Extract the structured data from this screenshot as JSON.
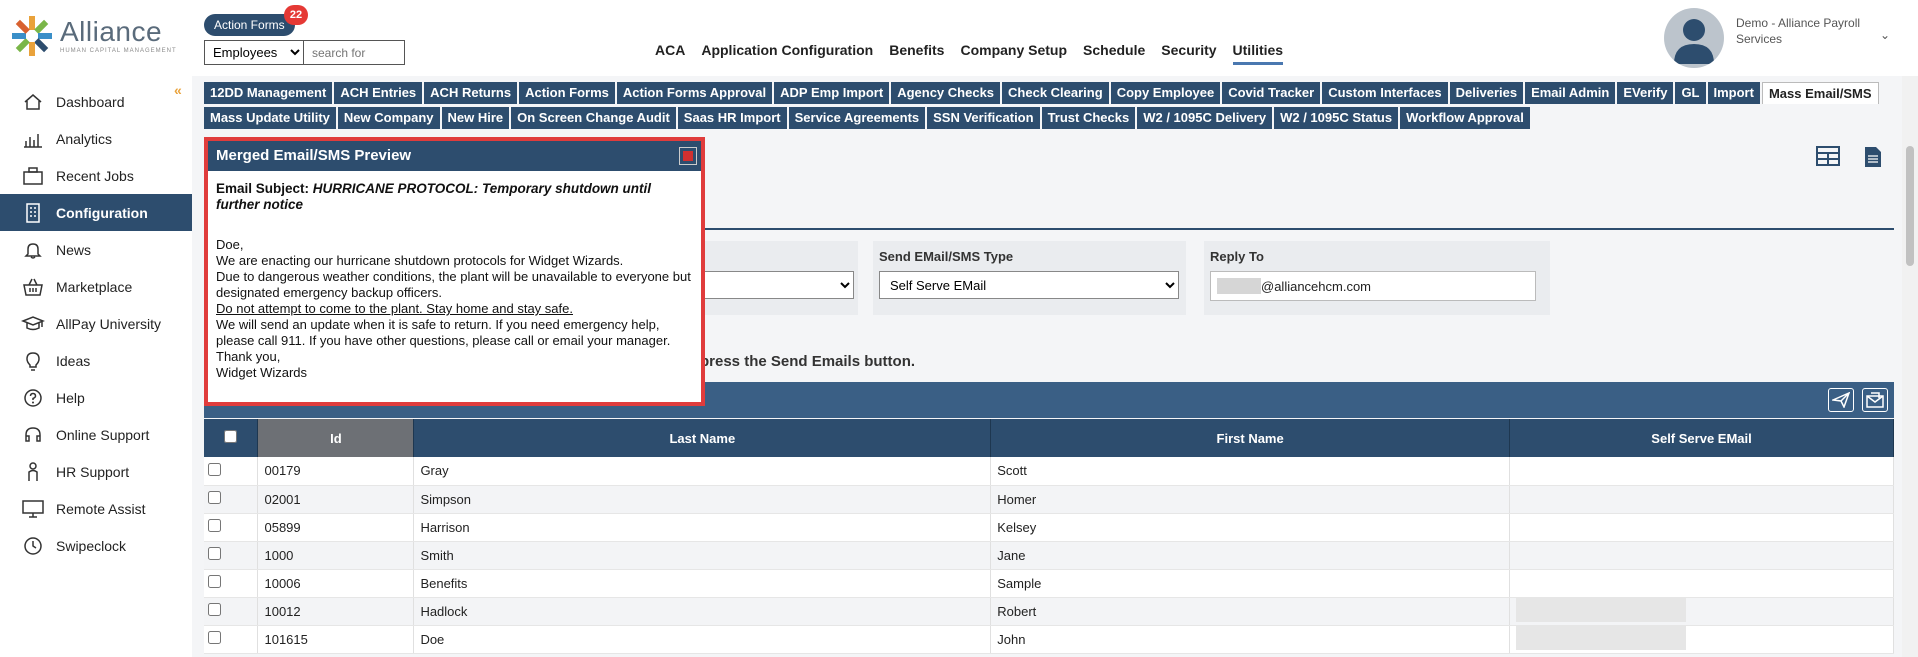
{
  "brand": {
    "name": "Alliance",
    "tagline": "HUMAN CAPITAL MANAGEMENT"
  },
  "header": {
    "action_forms_label": "Action Forms",
    "action_forms_count": "22",
    "employee_select_value": "Employees",
    "search_placeholder": "search for",
    "nav": [
      "ACA",
      "Application Configuration",
      "Benefits",
      "Company Setup",
      "Schedule",
      "Security",
      "Utilities"
    ],
    "active_nav": "Utilities",
    "user_name": "Demo - Alliance Payroll Services"
  },
  "sidebar": {
    "items": [
      {
        "label": "Dashboard",
        "icon": "home-icon"
      },
      {
        "label": "Analytics",
        "icon": "analytics-icon"
      },
      {
        "label": "Recent Jobs",
        "icon": "briefcase-icon"
      },
      {
        "label": "Configuration",
        "icon": "building-icon"
      },
      {
        "label": "News",
        "icon": "bell-icon"
      },
      {
        "label": "Marketplace",
        "icon": "basket-icon"
      },
      {
        "label": "AllPay University",
        "icon": "graduation-cap-icon"
      },
      {
        "label": "Ideas",
        "icon": "lightbulb-icon"
      },
      {
        "label": "Help",
        "icon": "question-icon"
      },
      {
        "label": "Online Support",
        "icon": "headset-icon"
      },
      {
        "label": "HR Support",
        "icon": "person-icon"
      },
      {
        "label": "Remote Assist",
        "icon": "monitor-icon"
      },
      {
        "label": "Swipeclock",
        "icon": "clock-icon"
      }
    ],
    "active": "Configuration"
  },
  "tabs": {
    "row1": [
      "12DD Management",
      "ACH Entries",
      "ACH Returns",
      "Action Forms",
      "Action Forms Approval",
      "ADP Emp Import",
      "Agency Checks",
      "Check Clearing",
      "Copy Employee",
      "Covid Tracker",
      "Custom Interfaces",
      "Deliveries",
      "Email Admin",
      "EVerify",
      "GL",
      "Import",
      "Mass Email/SMS"
    ],
    "row2": [
      "Mass Update Utility",
      "New Company",
      "New Hire",
      "On Screen Change Audit",
      "Saas HR Import",
      "Service Agreements",
      "SSN Verification",
      "Trust Checks",
      "W2 / 1095C Delivery",
      "W2 / 1095C Status",
      "Workflow Approval"
    ],
    "active": "Mass Email/SMS"
  },
  "form": {
    "send_type_label": "Send EMail/SMS Type",
    "send_type_value": "Self Serve EMail",
    "reply_to_label": "Reply To",
    "reply_to_value": "@alliancehcm.com"
  },
  "instruction": "press the Send Emails button.",
  "grid": {
    "columns": [
      "Id",
      "Last Name",
      "First Name",
      "Self Serve EMail"
    ],
    "rows": [
      [
        "00179",
        "Gray",
        "Scott"
      ],
      [
        "02001",
        "Simpson",
        "Homer"
      ],
      [
        "05899",
        "Harrison",
        "Kelsey"
      ],
      [
        "1000",
        "Smith",
        "Jane"
      ],
      [
        "10006",
        "Benefits",
        "Sample"
      ],
      [
        "10012",
        "Hadlock",
        "Robert"
      ],
      [
        "101615",
        "Doe",
        "John"
      ]
    ]
  },
  "modal": {
    "title": "Merged Email/SMS Preview",
    "subject_label": "Email Subject:",
    "subject_value": "HURRICANE PROTOCOL: Temporary shutdown until further notice",
    "greeting": "Doe,",
    "line1": "We are enacting our hurricane shutdown protocols for Widget Wizards.",
    "line2": "Due to dangerous weather conditions, the plant will be unavailable to everyone but designated emergency backup officers.",
    "line3": "Do not attempt to come to the plant. Stay home and stay safe.",
    "line4": "We will send an update when it is safe to return. If you need emergency help, please call 911. If you have other questions, please call or email your manager.",
    "line5": "Thank you,",
    "line6": "Widget Wizards"
  },
  "colors": {
    "primary": "#2d4d6e",
    "accent": "#4a78b0",
    "badge": "#e53935",
    "modal_border": "#e03c3c",
    "collapse": "#e9a23b"
  }
}
